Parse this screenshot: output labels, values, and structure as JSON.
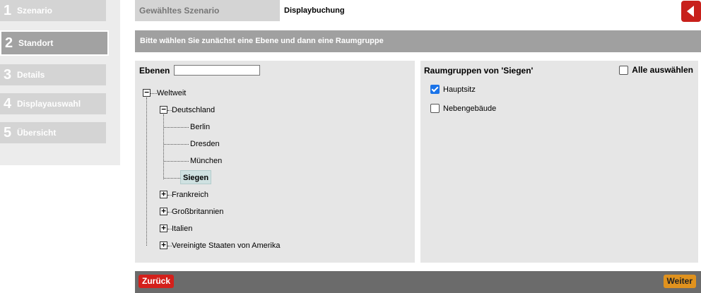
{
  "wizard": {
    "steps": [
      {
        "num": "1",
        "label": "Szenario"
      },
      {
        "num": "2",
        "label": "Standort"
      },
      {
        "num": "3",
        "label": "Details"
      },
      {
        "num": "4",
        "label": "Displayauswahl"
      },
      {
        "num": "5",
        "label": "Übersicht"
      }
    ],
    "active_step": "2"
  },
  "header": {
    "label": "Gewähltes Szenario",
    "value": "Displaybuchung"
  },
  "instruction": "Bitte wählen Sie zunächst eine Ebene und dann eine Raumgruppe",
  "ebenen": {
    "title": "Ebenen",
    "filter_value": "",
    "tree": {
      "root": "Weltweit",
      "countries": [
        "Deutschland",
        "Frankreich",
        "Großbritannien",
        "Italien",
        "Vereinigte Staaten von Amerika"
      ],
      "cities": [
        "Berlin",
        "Dresden",
        "München",
        "Siegen"
      ],
      "selected": "Siegen"
    }
  },
  "raumgruppen": {
    "title": "Raumgruppen von 'Siegen'",
    "select_all_label": "Alle auswählen",
    "select_all_checked": false,
    "items": [
      {
        "label": "Hauptsitz",
        "checked": true
      },
      {
        "label": "Nebengebäude",
        "checked": false
      }
    ]
  },
  "footer": {
    "back_label": "Zurück",
    "next_label": "Weiter"
  },
  "colors": {
    "back_accent": "#c8201b",
    "next_accent": "#e0921e",
    "checkbox_checked": "#1a73e8"
  }
}
